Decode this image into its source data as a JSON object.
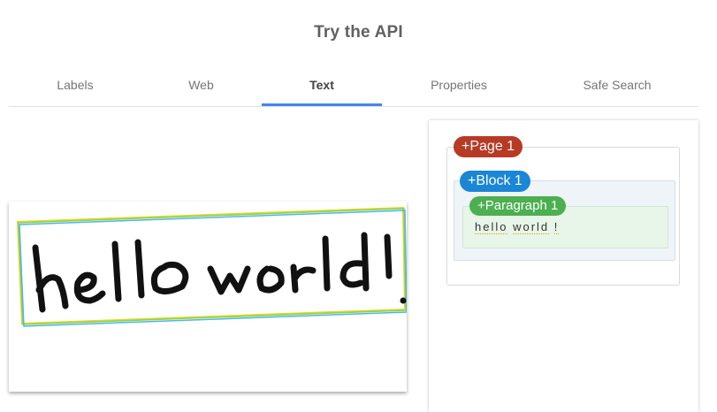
{
  "header": {
    "title": "Try the API"
  },
  "tabs": [
    {
      "label": "Labels",
      "active": false
    },
    {
      "label": "Web",
      "active": false
    },
    {
      "label": "Text",
      "active": true
    },
    {
      "label": "Properties",
      "active": false
    },
    {
      "label": "Safe Search",
      "active": false
    }
  ],
  "image": {
    "handwritten_text": "hello world!"
  },
  "results": {
    "page_label": "+Page 1",
    "block_label": "+Block 1",
    "paragraph_label": "+Paragraph 1",
    "words": [
      "hello",
      "world",
      "!"
    ]
  },
  "colors": {
    "accent": "#4285f4",
    "page_badge": "#b73a25",
    "block_badge": "#1a86d6",
    "paragraph_badge": "#4caf50"
  }
}
